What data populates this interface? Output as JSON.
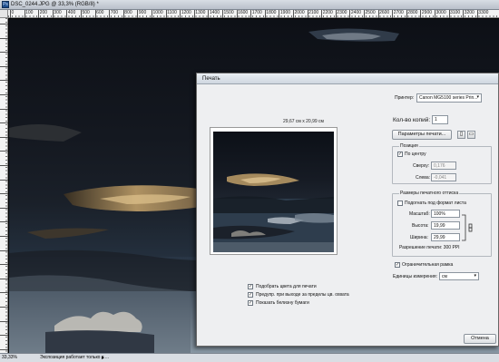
{
  "document": {
    "title": "DSC_0244.JPG @ 33,3% (RGB/8) *",
    "ruler_marks": [
      "0",
      "100",
      "200",
      "300",
      "400",
      "500",
      "600",
      "700",
      "800",
      "900",
      "1000",
      "1100",
      "1200",
      "1300",
      "1400",
      "1500",
      "1600",
      "1700",
      "1800",
      "1900",
      "2000",
      "2100",
      "2200",
      "2300",
      "2400",
      "2500",
      "2600",
      "2700",
      "2800",
      "2900",
      "3000",
      "3100",
      "3200",
      "3300"
    ]
  },
  "status": {
    "zoom": "33,33%",
    "info": "Экспозиция работает только в ..."
  },
  "dialog": {
    "title": "Печать",
    "preview_size": "29,67 см x 20,99 см",
    "printer_label": "Принтер:",
    "printer_value": "Canon MG5100 series Prin...",
    "copies_label": "Кол-во копий:",
    "copies_value": "1",
    "print_params_button": "Параметры печати...",
    "position": {
      "title": "Позиция",
      "center_label": "По центру",
      "center_checked": true,
      "top_label": "Сверху:",
      "top_value": "0,176",
      "left_label": "Слева:",
      "left_value": "-0,041"
    },
    "scaled_size": {
      "title": "Размеры печатного оттиска",
      "fit_label": "Подогнать под формат листа",
      "fit_checked": false,
      "scale_label": "Масштаб:",
      "scale_value": "100%",
      "height_label": "Высота:",
      "height_value": "19,99",
      "width_label": "Ширина:",
      "width_value": "29,99",
      "resolution_text": "Разрешение печати: 300 PPI"
    },
    "bounding_box_label": "Ограничительная рамка",
    "bounding_box_checked": true,
    "units_label": "Единицы измерения:",
    "units_value": "см",
    "options": [
      {
        "label": "Подобрать цвета для печати",
        "checked": true
      },
      {
        "label": "Предупр. при выходе за пределы цв. охвата",
        "checked": true
      },
      {
        "label": "Показать белизну бумаги",
        "checked": true
      }
    ],
    "cancel_button": "Отмена"
  }
}
